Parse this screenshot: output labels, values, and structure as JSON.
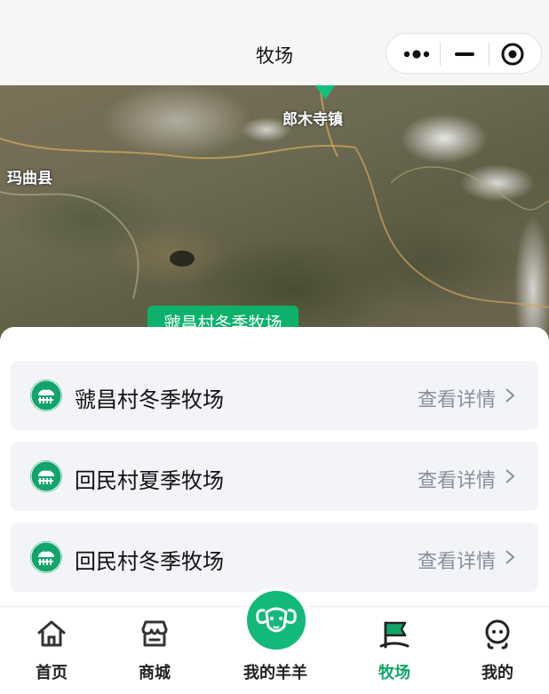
{
  "navbar": {
    "title": "牧场",
    "capsule": {
      "more_icon": "more-dots-icon",
      "minimize_icon": "minimize-icon",
      "close_icon": "target-circle-icon"
    }
  },
  "map": {
    "labels": {
      "town": "郎木寺镇",
      "county": "玛曲县"
    },
    "callout": "虢昌村冬季牧场"
  },
  "pastures": [
    {
      "name": "虢昌村冬季牧场",
      "detail": "查看详情"
    },
    {
      "name": "回民村夏季牧场",
      "detail": "查看详情"
    },
    {
      "name": "回民村冬季牧场",
      "detail": "查看详情"
    }
  ],
  "tabbar": {
    "items": [
      {
        "label": "首页",
        "icon": "home-icon"
      },
      {
        "label": "商城",
        "icon": "shop-icon"
      },
      {
        "label": "我的羊羊",
        "icon": "ram-head-icon"
      },
      {
        "label": "牧场",
        "icon": "pasture-flag-icon"
      },
      {
        "label": "我的",
        "icon": "user-face-icon"
      }
    ],
    "active": "牧场"
  },
  "colors": {
    "accent": "#0fa568",
    "card_bg": "#f3f4f8",
    "detail_text": "#8a8f99"
  }
}
